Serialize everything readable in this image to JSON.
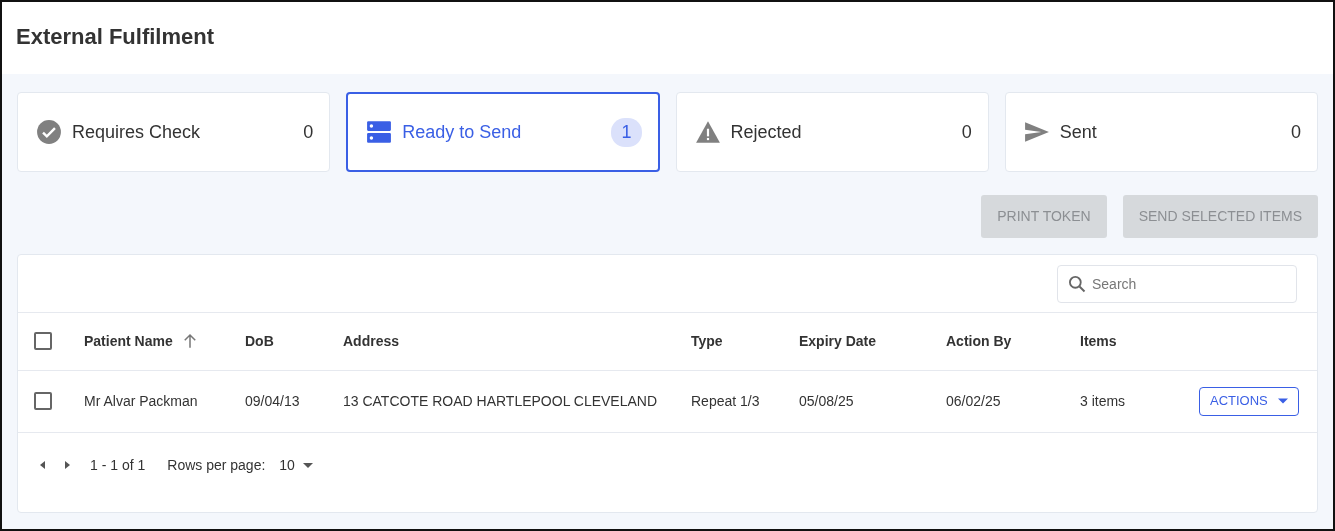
{
  "page": {
    "title": "External Fulfilment"
  },
  "tiles": [
    {
      "kind": "check",
      "label": "Requires Check",
      "count": "0",
      "selected": false
    },
    {
      "kind": "server",
      "label": "Ready to Send",
      "count": "1",
      "selected": true
    },
    {
      "kind": "warning",
      "label": "Rejected",
      "count": "0",
      "selected": false
    },
    {
      "kind": "send",
      "label": "Sent",
      "count": "0",
      "selected": false
    }
  ],
  "buttons": [
    {
      "label": "PRINT TOKEN",
      "disabled": true
    },
    {
      "label": "SEND SELECTED ITEMS",
      "disabled": true
    }
  ],
  "search": {
    "placeholder": "Search"
  },
  "table": {
    "select_all": {
      "checked": false
    },
    "columns": [
      {
        "label": "Patient Name",
        "sorted": true
      },
      {
        "label": "DoB",
        "sorted": false
      },
      {
        "label": "Address",
        "sorted": false
      },
      {
        "label": "Type",
        "sorted": false
      },
      {
        "label": "Expiry Date",
        "sorted": false
      },
      {
        "label": "Action By",
        "sorted": false
      },
      {
        "label": "Items",
        "sorted": false
      }
    ],
    "rows": [
      {
        "checked": false,
        "cells": [
          "Mr Alvar Packman",
          "09/04/13",
          "13 CATCOTE ROAD HARTLEPOOL CLEVELAND",
          "Repeat 1/3",
          "05/08/25",
          "06/02/25",
          "3 items"
        ],
        "action": "ACTIONS"
      }
    ]
  },
  "pagination": {
    "range": "1 - 1 of 1",
    "rows_label": "Rows per page:",
    "rows_value": "10"
  }
}
